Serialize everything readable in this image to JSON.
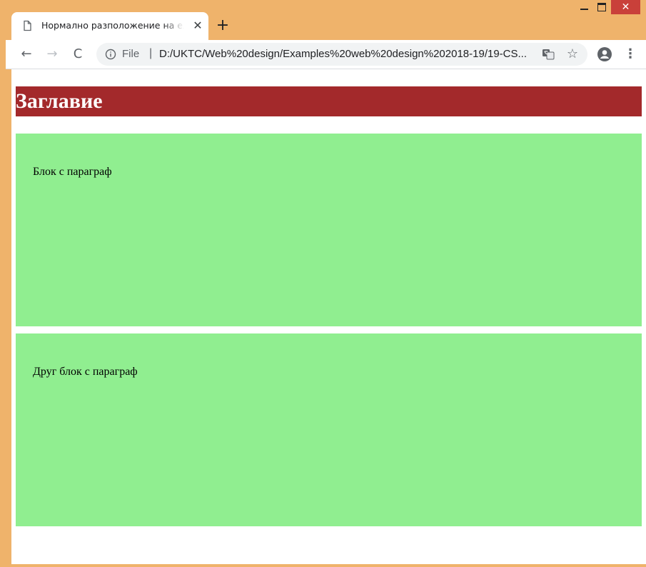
{
  "browser": {
    "tab_title": "Нормално разположение на елементи",
    "tab_close": "✕",
    "new_tab": "+",
    "window_close": "✕",
    "nav_back": "←",
    "nav_forward": "→",
    "nav_reload": "C",
    "url_scheme": "File",
    "url_separator": "|",
    "url": "D:/UKTC/Web%20design/Examples%20web%20design%202018-19/19-CS...",
    "star": "☆",
    "menu": "⋮",
    "colors": {
      "frame": "#efb36b",
      "close_button": "#c9403a"
    }
  },
  "page": {
    "heading": "Заглавие",
    "block1_text": "Блок с параграф",
    "block2_text": "Друг блок с параграф",
    "colors": {
      "heading_bg": "#a3292b",
      "block_bg": "#90ee90"
    }
  }
}
